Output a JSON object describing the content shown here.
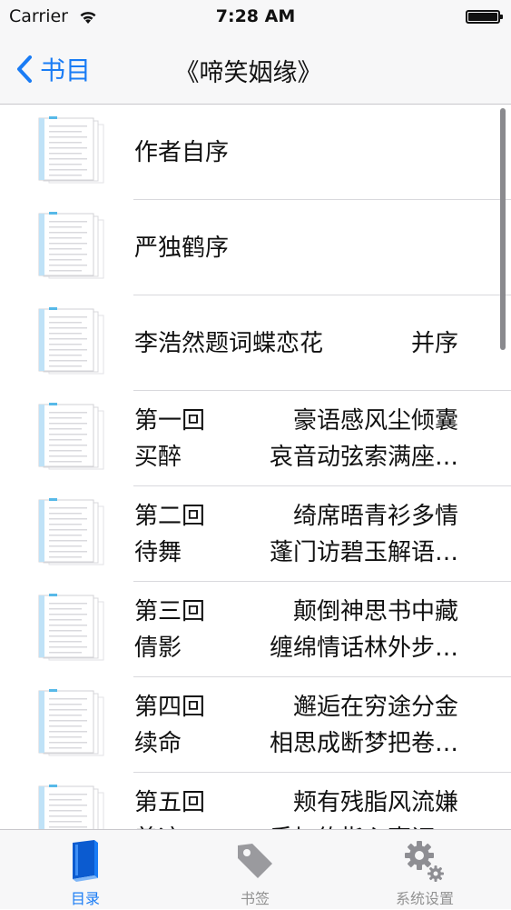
{
  "status": {
    "carrier": "Carrier",
    "time": "7:28 AM"
  },
  "nav": {
    "back_label": "书目",
    "title": "《啼笑姻缘》"
  },
  "chapters": [
    {
      "a": "作者自序",
      "b": "",
      "c": "",
      "d": ""
    },
    {
      "a": "严独鹤序",
      "b": "",
      "c": "",
      "d": ""
    },
    {
      "a": "李浩然题词蝶恋花",
      "b": "并序",
      "c": "",
      "d": ""
    },
    {
      "a": "第一回",
      "b": "豪语感风尘倾囊",
      "c": "买醉",
      "d": "哀音动弦索满座…"
    },
    {
      "a": "第二回",
      "b": "绮席晤青衫多情",
      "c": "待舞",
      "d": "蓬门访碧玉解语…"
    },
    {
      "a": "第三回",
      "b": "颠倒神思书中藏",
      "c": "倩影",
      "d": "缠绵情话林外步…"
    },
    {
      "a": "第四回",
      "b": "邂逅在穷途分金",
      "c": "续命",
      "d": "相思成断梦把卷…"
    },
    {
      "a": "第五回",
      "b": "颊有残脂风流嫌",
      "c": "着迹",
      "d": "手加约指心事证…"
    }
  ],
  "tabs": [
    {
      "label": "目录",
      "active": true
    },
    {
      "label": "书签",
      "active": false
    },
    {
      "label": "系统设置",
      "active": false
    }
  ],
  "colors": {
    "accent": "#1a7cf5",
    "inactive": "#929292"
  }
}
